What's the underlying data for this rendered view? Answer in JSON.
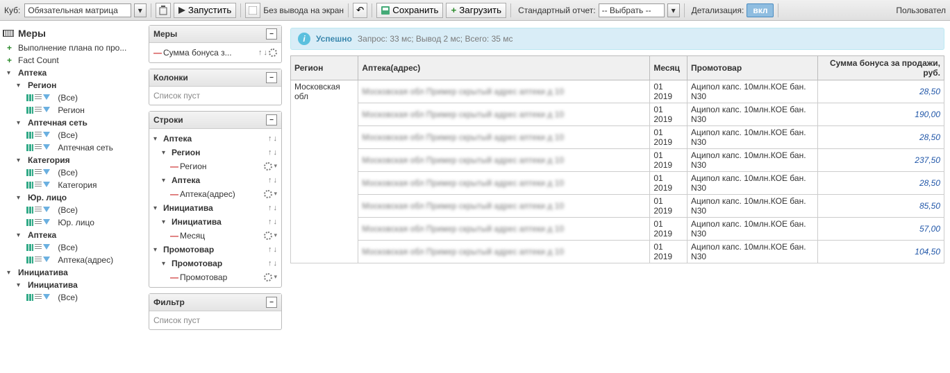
{
  "toolbar": {
    "cube_label": "Куб:",
    "cube_value": "Обязательная матрица",
    "run": "Запустить",
    "no_output": "Без вывода на экран",
    "save": "Сохранить",
    "load": "Загрузить",
    "std_report": "Стандартный отчет:",
    "std_report_value": "-- Выбрать --",
    "detail": "Детализация:",
    "detail_state": "вкл",
    "user": "Пользовател"
  },
  "left_tree": {
    "measures_title": "Меры",
    "plan": "Выполнение плана по про...",
    "fact": "Fact Count",
    "apteka": "Аптека",
    "region": "Регион",
    "all": "(Все)",
    "region2": "Регион",
    "aptset": "Аптечная сеть",
    "aptset2": "Аптечная сеть",
    "category": "Категория",
    "category2": "Категория",
    "yur": "Юр. лицо",
    "yur2": "Юр. лицо",
    "apteka2": "Аптека",
    "apteka_addr": "Аптека(адрес)",
    "initiative": "Инициатива",
    "initiative2": "Инициатива"
  },
  "panels": {
    "measures": {
      "title": "Меры",
      "item": "Сумма бонуса з..."
    },
    "columns": {
      "title": "Колонки",
      "empty": "Список пуст"
    },
    "rows": {
      "title": "Строки",
      "apteka": "Аптека",
      "region": "Регион",
      "region2": "Регион",
      "apteka2": "Аптека",
      "apteka_addr": "Аптека(адрес)",
      "initiative": "Инициатива",
      "initiative2": "Инициатива",
      "month": "Месяц",
      "promo": "Промотовар",
      "promo2": "Промотовар",
      "promo3": "Промотовар"
    },
    "filter": {
      "title": "Фильтр",
      "empty": "Список пуст"
    }
  },
  "status": {
    "ok": "Успешно",
    "text": "Запрос: 33 мс; Вывод 2 мс; Всего: 35 мс"
  },
  "table": {
    "headers": {
      "region": "Регион",
      "apteka": "Аптека(адрес)",
      "month": "Месяц",
      "promo": "Промотовар",
      "bonus": "Сумма бонуса за продажи, руб."
    },
    "region_value": "Московская обл",
    "rows": [
      {
        "month": "01 2019",
        "promo": "Аципол капс. 10млн.КОЕ бан. N30",
        "bonus": "28,50"
      },
      {
        "month": "01 2019",
        "promo": "Аципол капс. 10млн.КОЕ бан. N30",
        "bonus": "190,00"
      },
      {
        "month": "01 2019",
        "promo": "Аципол капс. 10млн.КОЕ бан. N30",
        "bonus": "28,50"
      },
      {
        "month": "01 2019",
        "promo": "Аципол капс. 10млн.КОЕ бан. N30",
        "bonus": "237,50"
      },
      {
        "month": "01 2019",
        "promo": "Аципол капс. 10млн.КОЕ бан. N30",
        "bonus": "28,50"
      },
      {
        "month": "01 2019",
        "promo": "Аципол капс. 10млн.КОЕ бан. N30",
        "bonus": "85,50"
      },
      {
        "month": "01 2019",
        "promo": "Аципол капс. 10млн.КОЕ бан. N30",
        "bonus": "57,00"
      },
      {
        "month": "01 2019",
        "promo": "Аципол капс. 10млн.КОЕ бан. N30",
        "bonus": "104,50"
      }
    ]
  }
}
